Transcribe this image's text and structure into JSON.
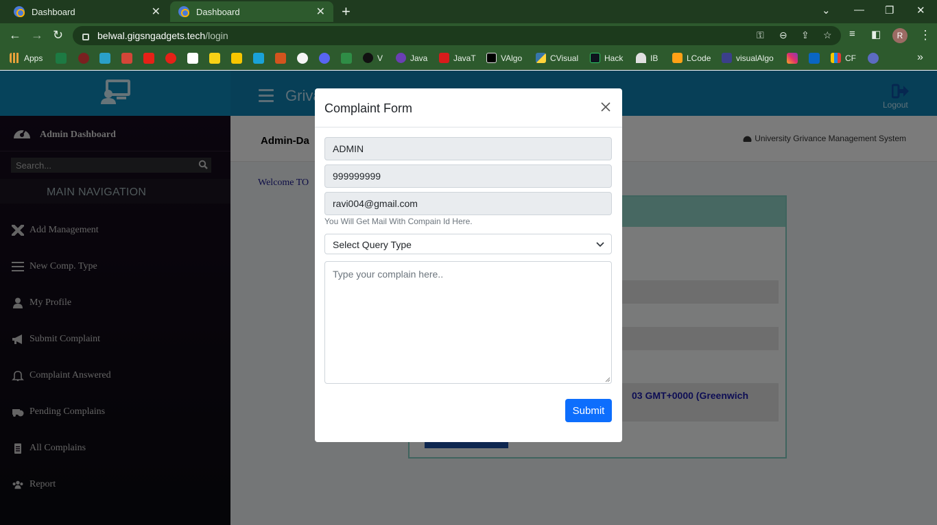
{
  "browser": {
    "tabs": [
      {
        "title": "Dashboard",
        "active": false
      },
      {
        "title": "Dashboard",
        "active": true
      }
    ],
    "url_host": "belwal.gigsngadgets.tech",
    "url_path": "/login",
    "profile_initial": "R",
    "bookmarks": [
      "Apps",
      "V",
      "Java",
      "JavaT",
      "VAlgo",
      "CVisual",
      "Hack",
      "IB",
      "LCode",
      "visualAlgo",
      "CF"
    ],
    "more_bookmarks": "»"
  },
  "header": {
    "app_name": "Griva",
    "logout_label": "Logout",
    "accent": "#0e7fae"
  },
  "sidebar": {
    "title": "Admin Dashboard",
    "search_placeholder": "Search...",
    "main_nav_label": "MAIN NAVIGATION",
    "items": [
      {
        "label": "Add Management",
        "icon": "tools-icon"
      },
      {
        "label": "New Comp. Type",
        "icon": "list-icon"
      },
      {
        "label": "My Profile",
        "icon": "user-icon"
      },
      {
        "label": "Submit Complaint",
        "icon": "megaphone-icon"
      },
      {
        "label": "Complaint Answered",
        "icon": "bell-icon"
      },
      {
        "label": "Pending Complains",
        "icon": "truck-clock-icon"
      },
      {
        "label": "All Complains",
        "icon": "clipboard-icon"
      },
      {
        "label": "Report",
        "icon": "users-icon"
      }
    ]
  },
  "content": {
    "page_title": "Admin-Da",
    "system_name": "University Grivance Management System",
    "welcome": "Welcome TO",
    "card_text": "03 GMT+0000 (Greenwich"
  },
  "modal": {
    "title": "Complaint Form",
    "name_value": "ADMIN",
    "phone_value": "999999999",
    "email_value": "ravi004@gmail.com",
    "email_help": "You Will Get Mail With Compain Id Here.",
    "query_type_selected": "Select Query Type",
    "complaint_placeholder": "Type your complain here..",
    "submit_label": "Submit",
    "submit_color": "#0d6efd"
  }
}
